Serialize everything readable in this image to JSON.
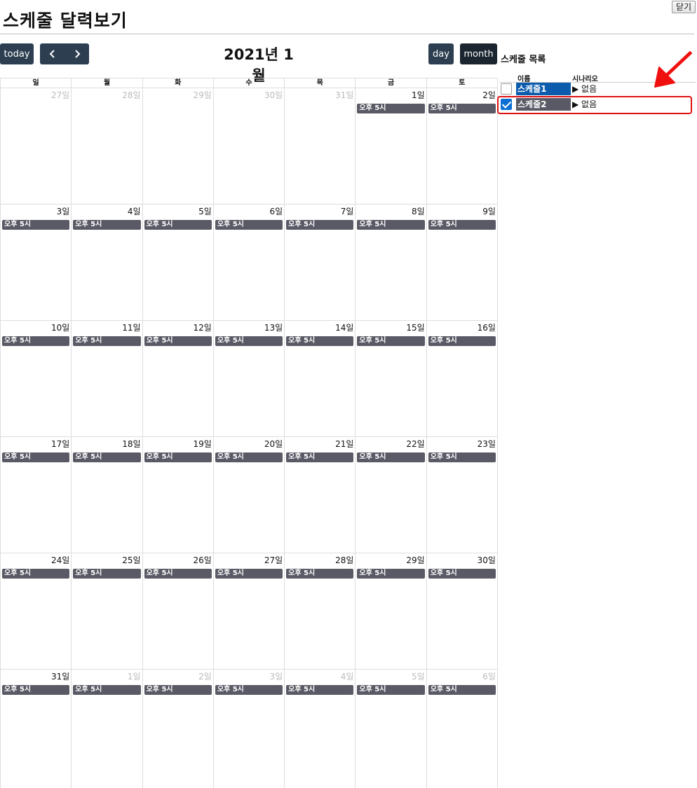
{
  "window": {
    "close_label": "닫기"
  },
  "page": {
    "title": "스케줄 달력보기"
  },
  "toolbar": {
    "today_label": "today",
    "prev_icon": "‹",
    "next_icon": "›",
    "day_label": "day",
    "month_label": "month",
    "current_month": "2021년 1월"
  },
  "calendar": {
    "weekdays": [
      "일",
      "월",
      "화",
      "수",
      "목",
      "금",
      "토"
    ],
    "event_color": "#5a5a66",
    "weeks": [
      {
        "days": [
          {
            "label": "27일",
            "other": true,
            "event": ""
          },
          {
            "label": "28일",
            "other": true,
            "event": ""
          },
          {
            "label": "29일",
            "other": true,
            "event": ""
          },
          {
            "label": "30일",
            "other": true,
            "event": ""
          },
          {
            "label": "31일",
            "other": true,
            "event": ""
          },
          {
            "label": "1일",
            "other": false,
            "event": "오후 5시"
          },
          {
            "label": "2일",
            "other": false,
            "event": "오후 5시"
          }
        ]
      },
      {
        "days": [
          {
            "label": "3일",
            "other": false,
            "event": "오후 5시"
          },
          {
            "label": "4일",
            "other": false,
            "event": "오후 5시"
          },
          {
            "label": "5일",
            "other": false,
            "event": "오후 5시"
          },
          {
            "label": "6일",
            "other": false,
            "event": "오후 5시"
          },
          {
            "label": "7일",
            "other": false,
            "event": "오후 5시"
          },
          {
            "label": "8일",
            "other": false,
            "event": "오후 5시"
          },
          {
            "label": "9일",
            "other": false,
            "event": "오후 5시"
          }
        ]
      },
      {
        "days": [
          {
            "label": "10일",
            "other": false,
            "event": "오후 5시"
          },
          {
            "label": "11일",
            "other": false,
            "event": "오후 5시"
          },
          {
            "label": "12일",
            "other": false,
            "event": "오후 5시"
          },
          {
            "label": "13일",
            "other": false,
            "event": "오후 5시"
          },
          {
            "label": "14일",
            "other": false,
            "event": "오후 5시"
          },
          {
            "label": "15일",
            "other": false,
            "event": "오후 5시"
          },
          {
            "label": "16일",
            "other": false,
            "event": "오후 5시"
          }
        ]
      },
      {
        "days": [
          {
            "label": "17일",
            "other": false,
            "event": "오후 5시"
          },
          {
            "label": "18일",
            "other": false,
            "event": "오후 5시"
          },
          {
            "label": "19일",
            "other": false,
            "event": "오후 5시"
          },
          {
            "label": "20일",
            "other": false,
            "event": "오후 5시"
          },
          {
            "label": "21일",
            "other": false,
            "event": "오후 5시"
          },
          {
            "label": "22일",
            "other": false,
            "event": "오후 5시"
          },
          {
            "label": "23일",
            "other": false,
            "event": "오후 5시"
          }
        ]
      },
      {
        "days": [
          {
            "label": "24일",
            "other": false,
            "event": "오후 5시"
          },
          {
            "label": "25일",
            "other": false,
            "event": "오후 5시"
          },
          {
            "label": "26일",
            "other": false,
            "event": "오후 5시"
          },
          {
            "label": "27일",
            "other": false,
            "event": "오후 5시"
          },
          {
            "label": "28일",
            "other": false,
            "event": "오후 5시"
          },
          {
            "label": "29일",
            "other": false,
            "event": "오후 5시"
          },
          {
            "label": "30일",
            "other": false,
            "event": "오후 5시"
          }
        ]
      },
      {
        "days": [
          {
            "label": "31일",
            "other": false,
            "event": "오후 5시"
          },
          {
            "label": "1일",
            "other": true,
            "event": "오후 5시"
          },
          {
            "label": "2일",
            "other": true,
            "event": "오후 5시"
          },
          {
            "label": "3일",
            "other": true,
            "event": "오후 5시"
          },
          {
            "label": "4일",
            "other": true,
            "event": "오후 5시"
          },
          {
            "label": "5일",
            "other": true,
            "event": "오후 5시"
          },
          {
            "label": "6일",
            "other": true,
            "event": "오후 5시"
          }
        ]
      }
    ]
  },
  "schedule_list": {
    "title": "스케줄 목록",
    "col_name": "이름",
    "col_scenario": "시나리오",
    "rows": [
      {
        "name": "스케줄1",
        "scenario": "▶ 없음",
        "checked": false,
        "color": "#0b5cad"
      },
      {
        "name": "스케줄2",
        "scenario": "▶ 없음",
        "checked": true,
        "color": "#5a5a66"
      }
    ]
  },
  "annotation": {
    "arrow_icon": "red-arrow-icon",
    "highlight_color": "#e01010"
  }
}
